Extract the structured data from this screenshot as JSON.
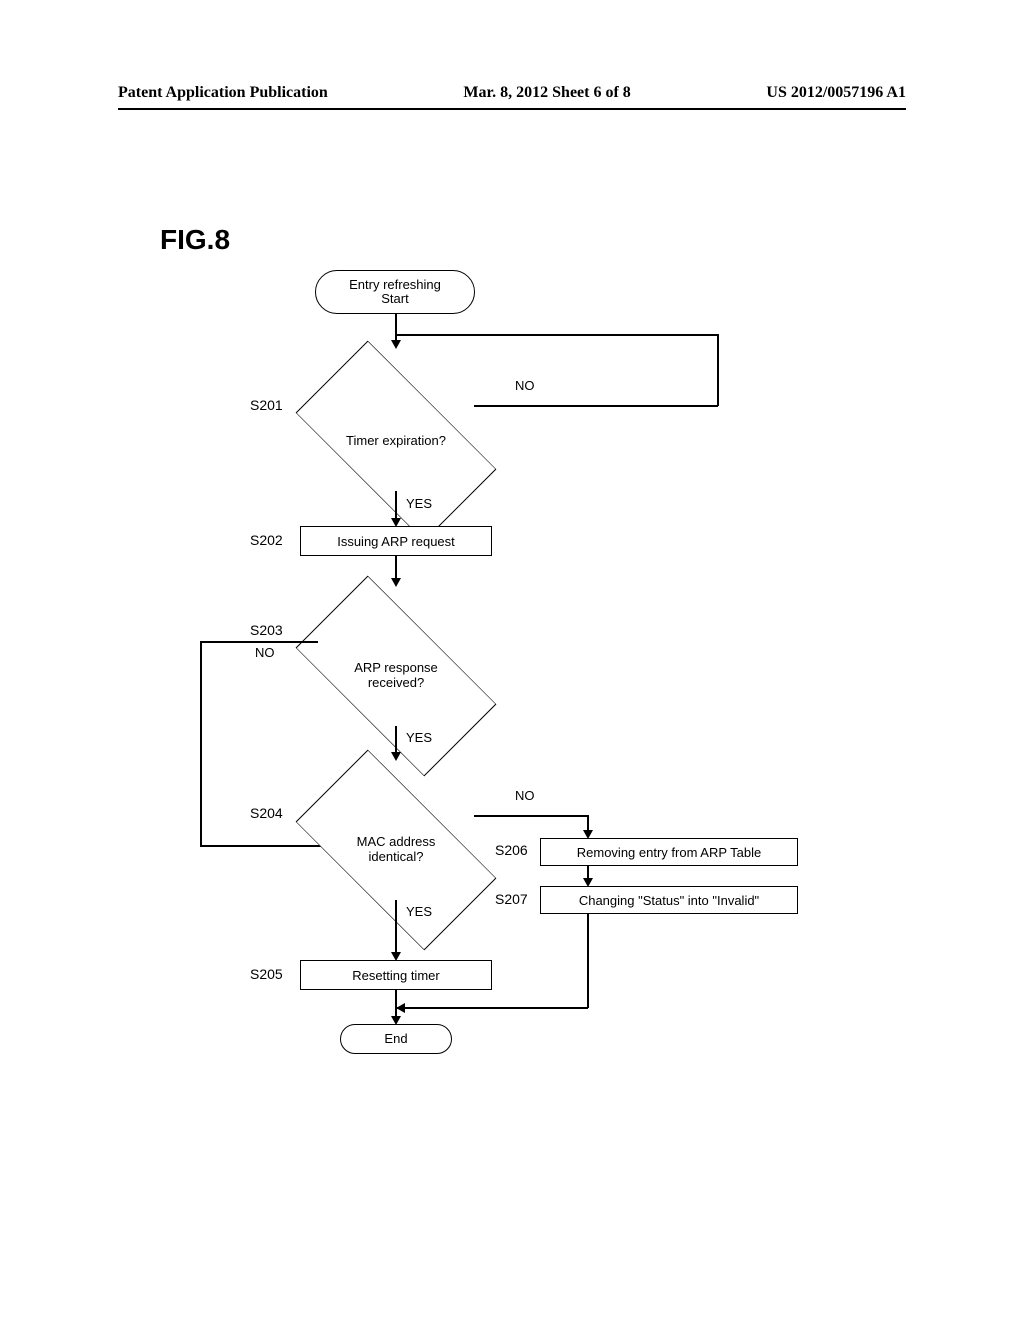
{
  "header": {
    "left": "Patent Application Publication",
    "mid": "Mar. 8, 2012  Sheet 6 of 8",
    "right": "US 2012/0057196 A1"
  },
  "figure_label": "FIG.8",
  "start": {
    "l1": "Entry refreshing",
    "l2": "Start"
  },
  "end": "End",
  "decisions": {
    "s201": {
      "label": "S201",
      "text": "Timer expiration?",
      "yes": "YES",
      "no": "NO"
    },
    "s203": {
      "label": "S203",
      "text_l1": "ARP response",
      "text_l2": "received?",
      "yes": "YES",
      "no": "NO"
    },
    "s204": {
      "label": "S204",
      "text_l1": "MAC address",
      "text_l2": "identical?",
      "yes": "YES",
      "no": "NO"
    }
  },
  "processes": {
    "s202": {
      "label": "S202",
      "text": "Issuing ARP request"
    },
    "s205": {
      "label": "S205",
      "text": "Resetting timer"
    },
    "s206": {
      "label": "S206",
      "text": "Removing entry from ARP Table"
    },
    "s207": {
      "label": "S207",
      "text": "Changing \"Status\"  into \"Invalid\""
    }
  }
}
